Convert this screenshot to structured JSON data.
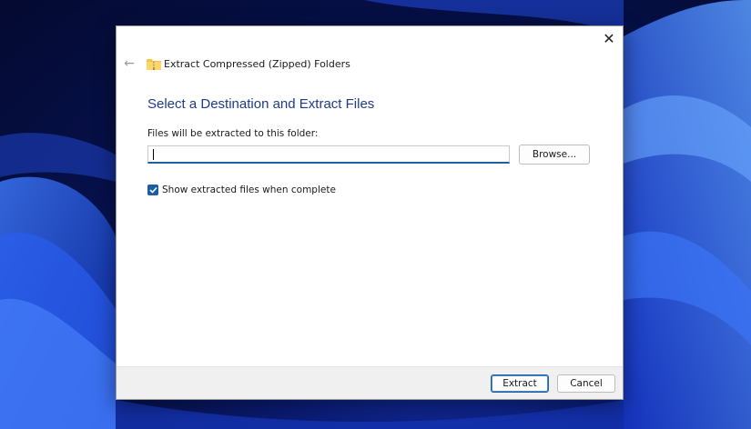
{
  "window": {
    "title": "Extract Compressed (Zipped) Folders",
    "close_icon": "close-icon",
    "back_icon": "back-arrow-icon",
    "folder_icon": "zipped-folder-icon"
  },
  "main": {
    "heading": "Select a Destination and Extract Files",
    "destination_label": "Files will be extracted to this folder:",
    "destination_value": "",
    "browse_label": "Browse...",
    "show_files_label": "Show extracted files when complete",
    "show_files_checked": true
  },
  "footer": {
    "extract_label": "Extract",
    "cancel_label": "Cancel"
  },
  "colors": {
    "heading": "#1e3a8a",
    "accent": "#1d5ea3",
    "footer_bg": "#f0f0f0"
  }
}
